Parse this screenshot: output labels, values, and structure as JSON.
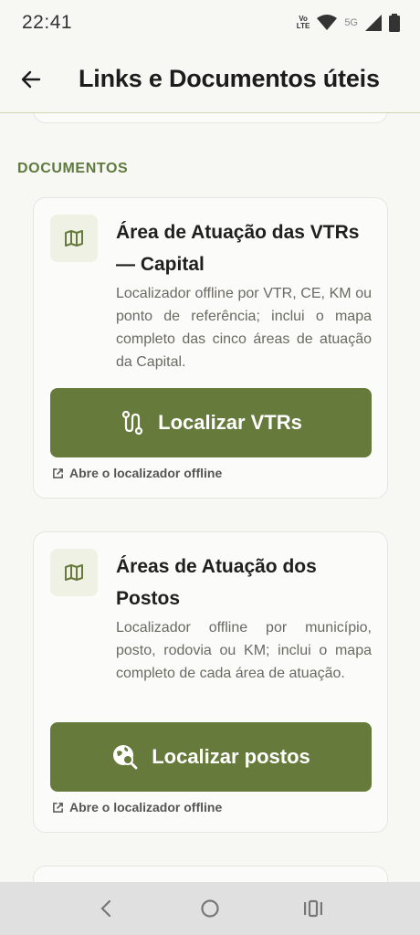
{
  "status_bar": {
    "time": "22:41",
    "volte_top": "Vo",
    "volte_bottom": "LTE",
    "network": "5G"
  },
  "app_bar": {
    "title": "Links e Documentos úteis",
    "back_icon": "arrow-left-icon"
  },
  "section": {
    "label": "DOCUMENTOS"
  },
  "cards": [
    {
      "title": "Área de Atuação das VTRs — Capital",
      "description": "Localizador offline por VTR, CE, KM ou ponto de referência; inclui o mapa completo das cinco áreas de atuação da Capital.",
      "button_label": "Localizar VTRs",
      "hint": "Abre o localizador offline",
      "icon": "map-icon",
      "button_icon": "route-icon"
    },
    {
      "title": "Áreas de Atuação dos Postos",
      "description": "Localizador offline por município, posto, rodovia ou KM; inclui o mapa completo de cada área de atuação.",
      "button_label": "Localizar postos",
      "hint": "Abre o localizador offline",
      "icon": "map-icon",
      "button_icon": "travel-explore-icon"
    }
  ],
  "colors": {
    "accent": "#667a3c",
    "section_label": "#5e7a3e",
    "background": "#f7f7f3"
  }
}
